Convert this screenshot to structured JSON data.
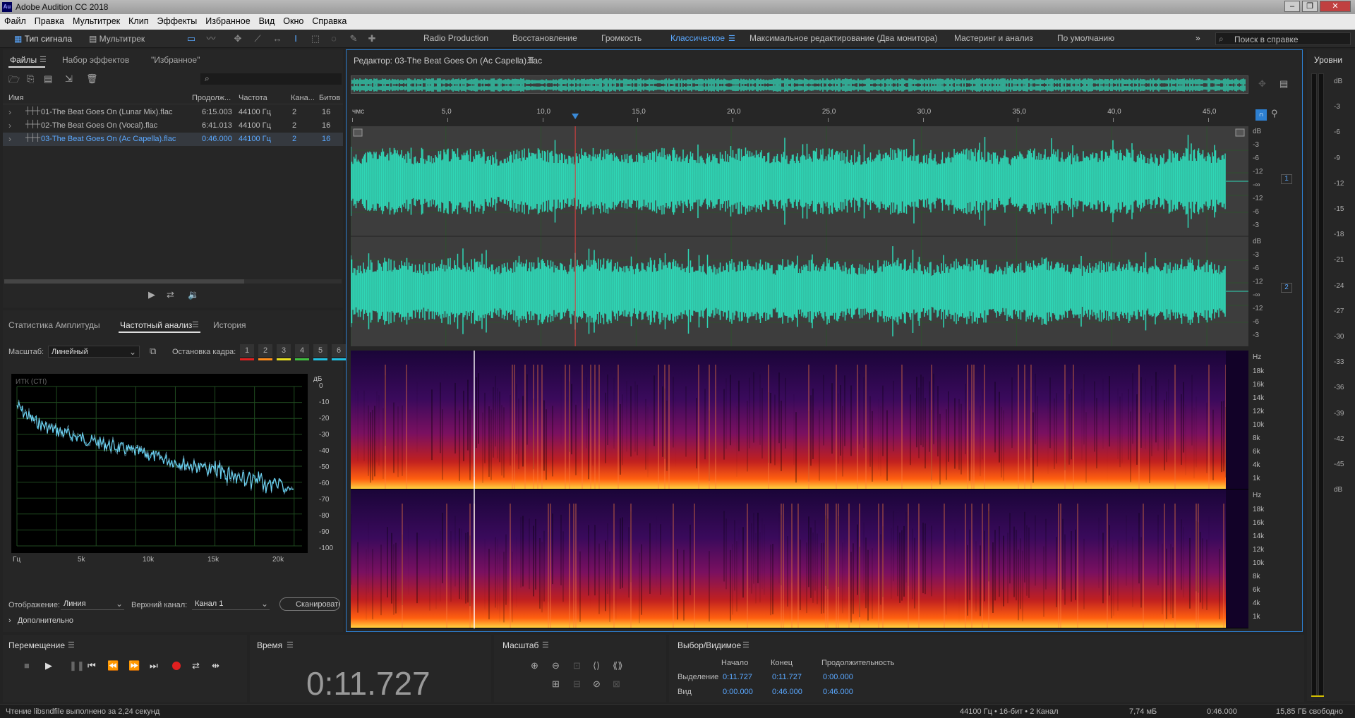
{
  "window": {
    "title": "Adobe Audition CC 2018",
    "app_icon": "Au"
  },
  "menu": [
    "Файл",
    "Правка",
    "Мультитрек",
    "Клип",
    "Эффекты",
    "Избранное",
    "Вид",
    "Окно",
    "Справка"
  ],
  "toolbar": {
    "waveform": "Тип сигнала",
    "multitrack": "Мультитрек",
    "search_placeholder": "Поиск в справке",
    "workspaces": [
      "Radio Production",
      "Восстановление",
      "Громкость",
      "Классическое",
      "Максимальное редактирование (Два монитора)",
      "Мастеринг и анализ",
      "По умолчанию"
    ]
  },
  "files": {
    "tabs": [
      "Файлы",
      "Набор эффектов",
      "\"Избранное\""
    ],
    "columns": [
      "Имя",
      "Продолж...",
      "Частота",
      "Кана...",
      "Битов"
    ],
    "rows": [
      {
        "name": "01-The Beat Goes On (Lunar Mix).flac",
        "dur": "6:15.003",
        "rate": "44100 Гц",
        "ch": "2",
        "bits": "16"
      },
      {
        "name": "02-The Beat Goes On (Vocal).flac",
        "dur": "6:41.013",
        "rate": "44100 Гц",
        "ch": "2",
        "bits": "16"
      },
      {
        "name": "03-The Beat Goes On (Ac Capella).flac",
        "dur": "0:46.000",
        "rate": "44100 Гц",
        "ch": "2",
        "bits": "16"
      }
    ]
  },
  "analysis": {
    "tabs": [
      "Статистика Амплитуды",
      "Частотный анализ",
      "История"
    ],
    "scale_label": "Масштаб:",
    "scale_value": "Линейный",
    "freeze_label": "Остановка кадра:",
    "freeze_buttons": [
      "1",
      "2",
      "3",
      "4",
      "5",
      "6"
    ],
    "freeze_colors": [
      "#e02020",
      "#ff8c1a",
      "#e8e020",
      "#40c040",
      "#20c0e0",
      "#20c0e0"
    ],
    "plot_label": "ИТК (СТI)",
    "db_unit": "дБ",
    "db_ticks": [
      "0",
      "-10",
      "-20",
      "-30",
      "-40",
      "-50",
      "-60",
      "-70",
      "-80",
      "-90",
      "-100"
    ],
    "freq_ticks": [
      "Гц",
      "5k",
      "10k",
      "15k",
      "20k"
    ],
    "display_label": "Отображение:",
    "display_value": "Линия",
    "channel_label": "Верхний канал:",
    "channel_value": "Канал 1",
    "scan": "Сканировать",
    "advanced": "Дополнительно"
  },
  "editor": {
    "title": "Редактор: 03-The Beat Goes On (Ac Capella).flac",
    "ruler_ticks": [
      "чмс",
      "5,0",
      "10,0",
      "15,0",
      "20,0",
      "25,0",
      "30,0",
      "35,0",
      "40,0",
      "45,0"
    ],
    "db_scale": [
      "dB",
      "-3",
      "-6",
      "-12",
      "-∞",
      "-12",
      "-6",
      "-3"
    ],
    "channels": [
      "1",
      "2"
    ],
    "hz_scale": [
      "Hz",
      "18k",
      "16k",
      "14k",
      "12k",
      "10k",
      "8k",
      "6k",
      "4k",
      "1k"
    ],
    "wave_color": "#2fd6b6",
    "playhead_seconds": 11.727,
    "duration_seconds": 46.0
  },
  "levels": {
    "title": "Уровни",
    "ticks": [
      "dB",
      "-3",
      "-6",
      "-9",
      "-12",
      "-15",
      "-18",
      "-21",
      "-24",
      "-27",
      "-30",
      "-33",
      "-36",
      "-39",
      "-42",
      "-45",
      "dB"
    ]
  },
  "transport": {
    "title": "Перемещение"
  },
  "time": {
    "title": "Время",
    "value": "0:11.727"
  },
  "zoom": {
    "title": "Масштаб"
  },
  "selection": {
    "title": "Выбор/Видимое",
    "col_start": "Начало",
    "col_end": "Конец",
    "col_dur": "Продолжительность",
    "rows": [
      {
        "label": "Выделение",
        "start": "0:11.727",
        "end": "0:11.727",
        "dur": "0:00.000"
      },
      {
        "label": "Вид",
        "start": "0:00.000",
        "end": "0:46.000",
        "dur": "0:46.000"
      }
    ]
  },
  "status": {
    "left": "Чтение libsndfile выполнено за 2,24 секунд",
    "format": "44100 Гц • 16-бит • 2 Канал",
    "size": "7,74 мБ",
    "duration": "0:46.000",
    "free": "15,85 ГБ свободно"
  }
}
